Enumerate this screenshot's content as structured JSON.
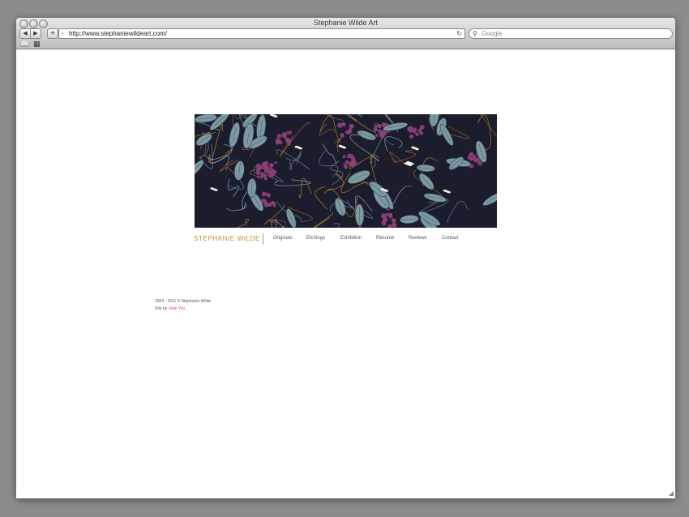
{
  "browser": {
    "window_title": "Stephanie Wilde Art",
    "url": "http://www.stephaniewildeart.com/",
    "search_placeholder": "Google",
    "back_glyph": "◀",
    "forward_glyph": "▶",
    "add_glyph": "+",
    "reload_glyph": "↻",
    "bookmarks_glyph": "📖",
    "topsites_glyph": "▦"
  },
  "site": {
    "brand": "STEPHANIE  WILDE",
    "nav": [
      "Originals",
      "Etchings",
      "Exhibition",
      "Resumé",
      "Reviews",
      "Contact"
    ],
    "footer": {
      "copyright": "2004 - 2011 © Stephanie Wilde",
      "credit_prefix": "Site by",
      "credit_name": "Jean You"
    }
  },
  "colors": {
    "brand": "#c9922b",
    "link": "#d23ca8",
    "banner_bg": "#1b1c2c",
    "leaf": "#7d9aa3",
    "flower": "#8e3f79"
  }
}
